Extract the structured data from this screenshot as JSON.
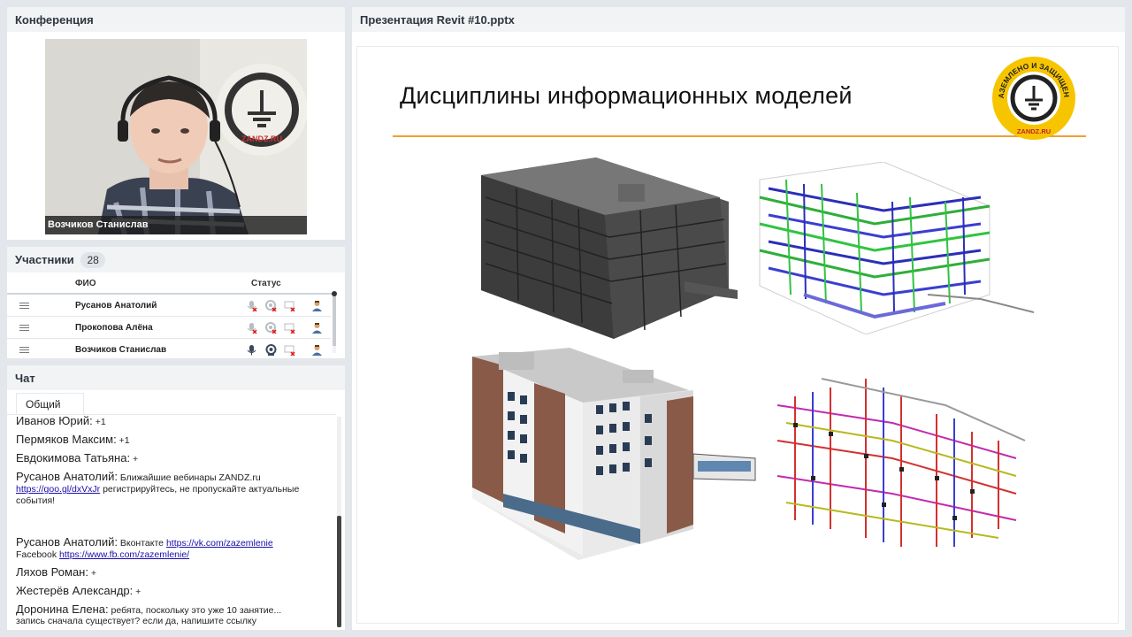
{
  "conference": {
    "title": "Конференция",
    "speaker_name": "Возчиков Станислав",
    "logo_text": "ЗАЗЕМЛЕНО И ЗАЩИЩЕНО",
    "logo_site": "ZANDZ.RU"
  },
  "participants": {
    "title": "Участники",
    "count": "28",
    "col_name": "ФИО",
    "col_status": "Статус",
    "rows": [
      {
        "name": "Русанов Анатолий",
        "mic": "off",
        "cam": "off",
        "screen": "off"
      },
      {
        "name": "Прокопова Алёна",
        "mic": "off",
        "cam": "off",
        "screen": "off"
      },
      {
        "name": "Возчиков Станислав",
        "mic": "on",
        "cam": "on",
        "screen": "off"
      }
    ]
  },
  "chat": {
    "title": "Чат",
    "tab": "Общий",
    "messages": [
      {
        "author": "Иванов Юрий:",
        "text": "+1"
      },
      {
        "author": "Пермяков Максим:",
        "text": "+1"
      },
      {
        "author": "Евдокимова Татьяна:",
        "text": "+"
      },
      {
        "author": "Русанов Анатолий:",
        "text": "Ближайшие вебинары ZANDZ.ru",
        "link": "https://goo.gl/dxVxJr",
        "text2": "регистрируйтесь, не пропускайте актуальные события!"
      },
      {
        "author": "Русанов Анатолий:",
        "text": "Вконтакте",
        "link": "https://vk.com/zazemlenie",
        "text2": "Facebook",
        "link2": "https://www.fb.com/zazemlenie/"
      },
      {
        "author": "Ляхов Роман:",
        "text": "+"
      },
      {
        "author": "Жестерёв Александр:",
        "text": "+"
      },
      {
        "author": "Доронина Елена:",
        "text": "ребята, поскольку это уже 10 занятие...",
        "text2": "запись сначала существует? если да, напишите ссылку"
      }
    ]
  },
  "presentation": {
    "title": "Презентация Revit #10.pptx",
    "slide_title": "Дисциплины информационных моделей",
    "logo_text": "ЗАЗЕМЛЕНО И ЗАЩИЩЕНО",
    "logo_site": "ZANDZ.RU"
  },
  "colors": {
    "accent_line": "#f0a030",
    "logo_yellow": "#f7c500",
    "panel_head": "#f1f3f5",
    "background": "#e3e6ea",
    "link": "#1a0dab"
  }
}
